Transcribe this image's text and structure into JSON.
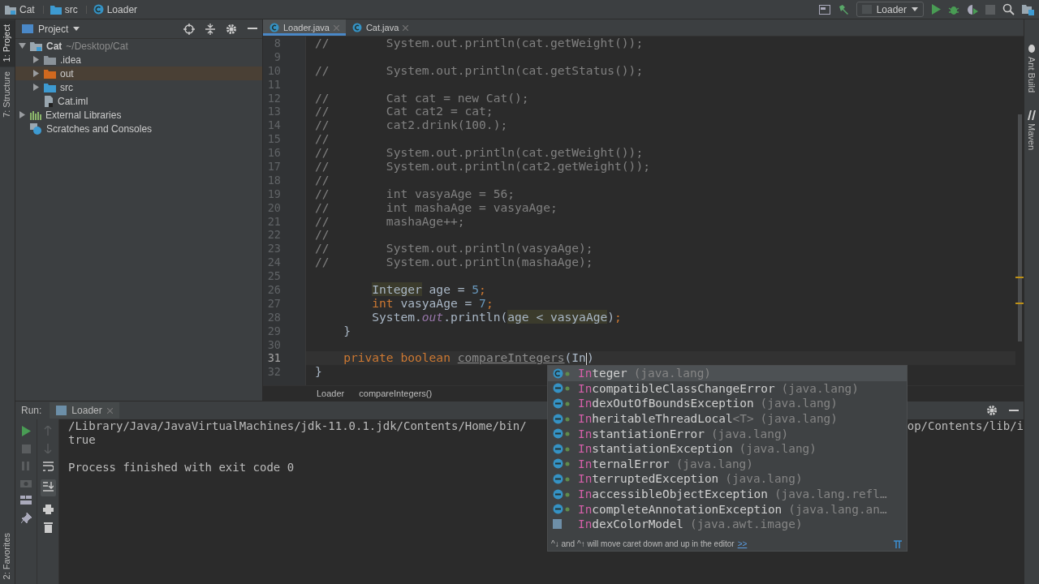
{
  "navbar": {
    "crumbs": [
      {
        "label": "Cat",
        "kind": "module"
      },
      {
        "label": "src",
        "kind": "folder"
      },
      {
        "label": "Loader",
        "kind": "class"
      }
    ],
    "run_config": "Loader"
  },
  "tool_strip_left": [
    {
      "label": "1: Project",
      "selected": true
    },
    {
      "label": "7: Structure",
      "selected": false
    }
  ],
  "tool_strip_left_bottom": [
    {
      "label": "2: Favorites",
      "selected": false
    }
  ],
  "tool_strip_right": [
    {
      "label": "Ant Build",
      "kind": "ant"
    },
    {
      "label": "Maven",
      "kind": "maven"
    }
  ],
  "project": {
    "title": "Project",
    "tree": [
      {
        "label": "Cat",
        "note": "~/Desktop/Cat",
        "kind": "module",
        "expanded": true,
        "selected": false,
        "children": [
          {
            "label": ".idea",
            "kind": "folder",
            "expanded": false,
            "selected": false
          },
          {
            "label": "out",
            "kind": "excluded-folder",
            "expanded": false,
            "selected": true
          },
          {
            "label": "src",
            "kind": "source-folder",
            "expanded": false,
            "selected": false
          },
          {
            "label": "Cat.iml",
            "kind": "file",
            "selected": false
          }
        ]
      },
      {
        "label": "External Libraries",
        "kind": "libraries",
        "expanded": false,
        "selected": false
      },
      {
        "label": "Scratches and Consoles",
        "kind": "scratches",
        "selected": false
      }
    ]
  },
  "editor": {
    "tabs": [
      {
        "label": "Loader.java",
        "selected": true
      },
      {
        "label": "Cat.java",
        "selected": false
      }
    ],
    "lines": [
      {
        "number": "8",
        "current": false,
        "segments": [
          {
            "text": "//        System.out.println(cat.getWeight());",
            "kind": "comment"
          }
        ]
      },
      {
        "number": "9",
        "current": false
      },
      {
        "number": "10",
        "current": false,
        "segments": [
          {
            "text": "//        System.out.println(cat.getStatus());",
            "kind": "comment"
          }
        ]
      },
      {
        "number": "11",
        "current": false
      },
      {
        "number": "12",
        "current": false,
        "segments": [
          {
            "text": "//        Cat cat = new Cat();",
            "kind": "comment"
          }
        ]
      },
      {
        "number": "13",
        "current": false,
        "segments": [
          {
            "text": "//        Cat cat2 = cat;",
            "kind": "comment"
          }
        ]
      },
      {
        "number": "14",
        "current": false,
        "segments": [
          {
            "text": "//        cat2.drink(100.);",
            "kind": "comment"
          }
        ]
      },
      {
        "number": "15",
        "current": false,
        "segments": [
          {
            "text": "//",
            "kind": "comment"
          }
        ]
      },
      {
        "number": "16",
        "current": false,
        "segments": [
          {
            "text": "//        System.out.println(cat.getWeight());",
            "kind": "comment"
          }
        ]
      },
      {
        "number": "17",
        "current": false,
        "segments": [
          {
            "text": "//        System.out.println(cat2.getWeight());",
            "kind": "comment"
          }
        ]
      },
      {
        "number": "18",
        "current": false,
        "segments": [
          {
            "text": "//",
            "kind": "comment"
          }
        ]
      },
      {
        "number": "19",
        "current": false,
        "segments": [
          {
            "text": "//        int vasyaAge = 56;",
            "kind": "comment"
          }
        ]
      },
      {
        "number": "20",
        "current": false,
        "segments": [
          {
            "text": "//        int mashaAge = vasyaAge;",
            "kind": "comment"
          }
        ]
      },
      {
        "number": "21",
        "current": false,
        "segments": [
          {
            "text": "//        mashaAge++;",
            "kind": "comment"
          }
        ]
      },
      {
        "number": "22",
        "current": false,
        "segments": [
          {
            "text": "//",
            "kind": "comment"
          }
        ]
      },
      {
        "number": "23",
        "current": false,
        "segments": [
          {
            "text": "//        System.out.println(vasyaAge);",
            "kind": "comment"
          }
        ]
      },
      {
        "number": "24",
        "current": false,
        "segments": [
          {
            "text": "//        System.out.println(mashaAge);",
            "kind": "comment"
          }
        ]
      },
      {
        "number": "25",
        "current": false
      },
      {
        "number": "26",
        "current": false,
        "kind": "statement",
        "segments": [
          {
            "text": "Integer",
            "kind": "highlight"
          },
          {
            "text": " age = ",
            "kind": "plain"
          },
          {
            "text": "5",
            "kind": "number"
          },
          {
            "text": ";",
            "kind": "punct"
          }
        ]
      },
      {
        "number": "27",
        "current": false,
        "kind": "statement",
        "segments": [
          {
            "text": "int",
            "kind": "keyword"
          },
          {
            "text": " vasyaAge = ",
            "kind": "plain"
          },
          {
            "text": "7",
            "kind": "number"
          },
          {
            "text": ";",
            "kind": "punct"
          }
        ]
      },
      {
        "number": "28",
        "current": false,
        "kind": "statement",
        "segments": [
          {
            "text": "System.",
            "kind": "plain"
          },
          {
            "text": "out",
            "kind": "field"
          },
          {
            "text": ".println(",
            "kind": "plain"
          },
          {
            "text": "age < vasyaAge",
            "kind": "highlight"
          },
          {
            "text": ")",
            "kind": "plain"
          },
          {
            "text": ";",
            "kind": "punct"
          }
        ]
      },
      {
        "number": "29",
        "current": false,
        "kind": "member",
        "segments": [
          {
            "text": "}",
            "kind": "plain"
          }
        ]
      },
      {
        "number": "30",
        "current": false
      },
      {
        "number": "31",
        "current": true,
        "kind": "member",
        "segments": [
          {
            "text": "private boolean ",
            "kind": "keyword"
          },
          {
            "text": "compareIntegers",
            "kind": "unused"
          },
          {
            "text": "(",
            "kind": "plain"
          },
          {
            "text": "In",
            "kind": "typed"
          },
          {
            "text": ")",
            "kind": "plain"
          }
        ]
      },
      {
        "number": "32",
        "current": false,
        "segments": [
          {
            "text": "}",
            "kind": "plain"
          }
        ]
      }
    ],
    "breadcrumbs": [
      "Loader",
      "compareIntegers()"
    ]
  },
  "completion": {
    "items": [
      {
        "match": "In",
        "rest": "teger",
        "package": "(java.lang)",
        "kind": "class",
        "selected": true
      },
      {
        "match": "In",
        "rest": "compatibleClassChangeError",
        "package": "(java.lang)",
        "kind": "exception",
        "selected": false
      },
      {
        "match": "In",
        "rest": "dexOutOfBoundsException",
        "package": "(java.lang)",
        "kind": "exception",
        "selected": false
      },
      {
        "match": "In",
        "rest": "heritableThreadLocal",
        "generic": "<T>",
        "package": "(java.lang)",
        "kind": "exception",
        "selected": false
      },
      {
        "match": "In",
        "rest": "stantiationError",
        "package": "(java.lang)",
        "kind": "exception",
        "selected": false
      },
      {
        "match": "In",
        "rest": "stantiationException",
        "package": "(java.lang)",
        "kind": "exception",
        "selected": false
      },
      {
        "match": "In",
        "rest": "ternalError",
        "package": "(java.lang)",
        "kind": "exception",
        "selected": false
      },
      {
        "match": "In",
        "rest": "terruptedException",
        "package": "(java.lang)",
        "kind": "exception",
        "selected": false
      },
      {
        "match": "In",
        "rest": "accessibleObjectException",
        "package": "(java.lang.refl…",
        "kind": "exception",
        "selected": false
      },
      {
        "match": "In",
        "rest": "completeAnnotationException",
        "package": "(java.lang.an…",
        "kind": "exception",
        "selected": false
      },
      {
        "match": "In",
        "rest": "dexColorModel",
        "package": "(java.awt.image)",
        "kind": "library",
        "selected": false
      }
    ],
    "hint": "^↓ and ^↑ will move caret down and up in the editor",
    "hint_link": ">>"
  },
  "run": {
    "label": "Run:",
    "tab": "Loader",
    "output": [
      {
        "kind": "line",
        "left": "/Library/Java/JavaVirtualMachines/jdk-11.0.1.jdk/Contents/Home/bin/",
        "right": "op/Contents/lib/i"
      },
      {
        "kind": "line",
        "left": "true"
      },
      {
        "kind": "blank"
      },
      {
        "kind": "line",
        "left": "Process finished with exit code 0"
      }
    ]
  }
}
